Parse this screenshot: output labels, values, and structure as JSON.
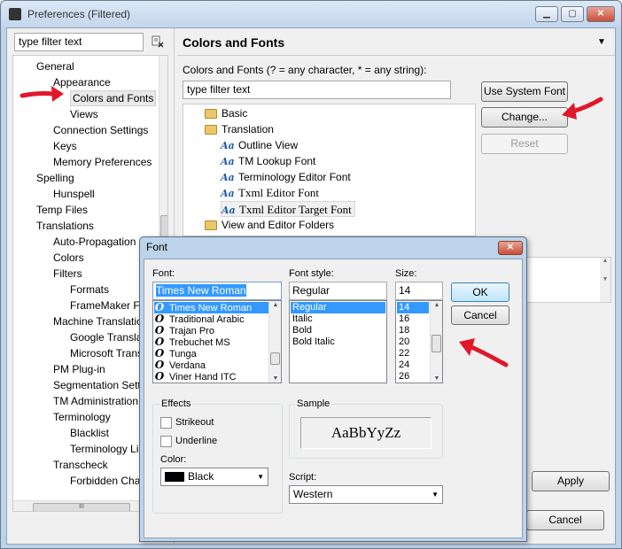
{
  "window": {
    "title": "Preferences (Filtered)",
    "min": "▁",
    "max": "▢",
    "close": "✕"
  },
  "sidebar": {
    "filter_value": "type filter text",
    "items": [
      "General",
      "Appearance",
      "Colors and Fonts",
      "Views",
      "Connection Settings",
      "Keys",
      "Memory Preferences",
      "Spelling",
      "Hunspell",
      "Temp Files",
      "Translations",
      "Auto-Propagation",
      "Colors",
      "Filters",
      "Formats",
      "FrameMaker Fil",
      "Machine Translatio",
      "Google Translat",
      "Microsoft Trans",
      "PM Plug-in",
      "Segmentation Setti",
      "TM Administration",
      "Terminology",
      "Blacklist",
      "Terminology Li",
      "Transcheck",
      "Forbidden Char"
    ],
    "hscroll_grip": "III"
  },
  "page": {
    "title": "Colors and Fonts",
    "description": "Colors and Fonts (? = any character, * = any string):",
    "filter_value": "type filter text",
    "tree": [
      {
        "label": "Basic",
        "icon": "folder-icon"
      },
      {
        "label": "Translation",
        "icon": "folder-icon"
      },
      {
        "label": "Outline View",
        "icon": "font-icon"
      },
      {
        "label": "TM Lookup Font",
        "icon": "font-icon"
      },
      {
        "label": "Terminology Editor Font",
        "icon": "font-icon"
      },
      {
        "label": "Txml Editor Font",
        "icon": "font-icon"
      },
      {
        "label": "Txml Editor Target Font",
        "icon": "font-icon"
      },
      {
        "label": "View and Editor Folders",
        "icon": "folder-icon"
      }
    ],
    "aa_glyph": "Aa",
    "buttons": {
      "use_system_font": "Use System Font",
      "change": "Change...",
      "reset": "Reset"
    },
    "apply": "Apply",
    "cancel": "Cancel"
  },
  "font_dialog": {
    "title": "Font",
    "close": "✕",
    "font_label": "Font:",
    "font_value": "Times New Roman",
    "fonts": [
      "Times New Roman",
      "Traditional Arabic",
      "Trajan Pro",
      "Trebuchet MS",
      "Tunga",
      "Verdana",
      "Viner Hand ITC"
    ],
    "tt_glyph": "O",
    "style_label": "Font style:",
    "style_value": "Regular",
    "styles": [
      "Regular",
      "Italic",
      "Bold",
      "Bold Italic"
    ],
    "size_label": "Size:",
    "size_value": "14",
    "sizes": [
      "14",
      "16",
      "18",
      "20",
      "22",
      "24",
      "26"
    ],
    "ok": "OK",
    "cancel": "Cancel",
    "effects_label": "Effects",
    "strikeout": "Strikeout",
    "underline": "Underline",
    "color_label": "Color:",
    "color_value": "Black",
    "sample_label": "Sample",
    "sample_text": "AaBbYyZz",
    "script_label": "Script:",
    "script_value": "Western"
  },
  "colors": {
    "selection": "#3399ff",
    "annotation_arrow": "#e0182a"
  }
}
